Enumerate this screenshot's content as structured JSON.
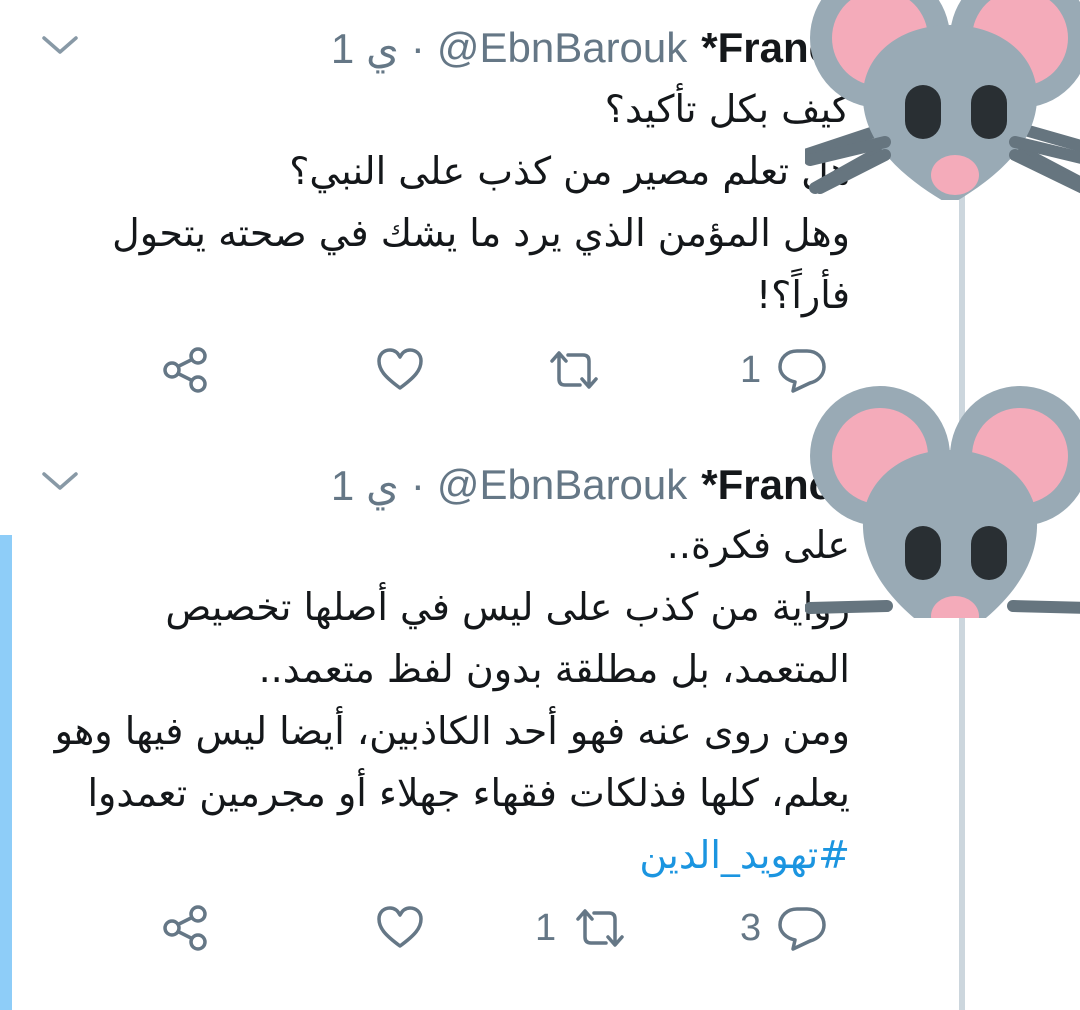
{
  "colors": {
    "text": "#14171a",
    "secondary": "#657786",
    "link": "#1b95e0",
    "thread_line": "#ccd6dd",
    "highlight_bar": "#8ecdf8",
    "mouse_gray": "#99aab5",
    "mouse_pink": "#f4abba"
  },
  "tweets": [
    {
      "author": "*Franc",
      "handle": "@EbnBarouk",
      "separator": "·",
      "time": "1 ي",
      "lines": [
        "كيف بكل تأكيد؟",
        "هل تعلم مصير من كذب على النبي؟",
        "وهل المؤمن الذي يرد ما يشك في صحته يتحول",
        "فأراً؟!"
      ],
      "hashtag": "",
      "reply_count": "1",
      "retweet_count": "",
      "icons": [
        "chevron-down-icon",
        "share-icon",
        "heart-icon",
        "retweet-icon",
        "reply-icon",
        "mouse-avatar"
      ]
    },
    {
      "author": "*Franc",
      "handle": "@EbnBarouk",
      "separator": "·",
      "time": "1 ي",
      "lines": [
        "على فكرة..",
        "رواية من كذب على ليس في أصلها تخصيص",
        "المتعمد، بل مطلقة بدون لفظ متعمد..",
        "ومن روى عنه فهو أحد الكاذبين، أيضا ليس فيها وهو",
        "يعلم، كلها فذلكات فقهاء جهلاء أو مجرمين تعمدوا"
      ],
      "hashtag": "#تهويد_الدين",
      "reply_count": "3",
      "retweet_count": "1",
      "icons": [
        "chevron-down-icon",
        "share-icon",
        "heart-icon",
        "retweet-icon",
        "reply-icon",
        "mouse-avatar"
      ]
    }
  ]
}
